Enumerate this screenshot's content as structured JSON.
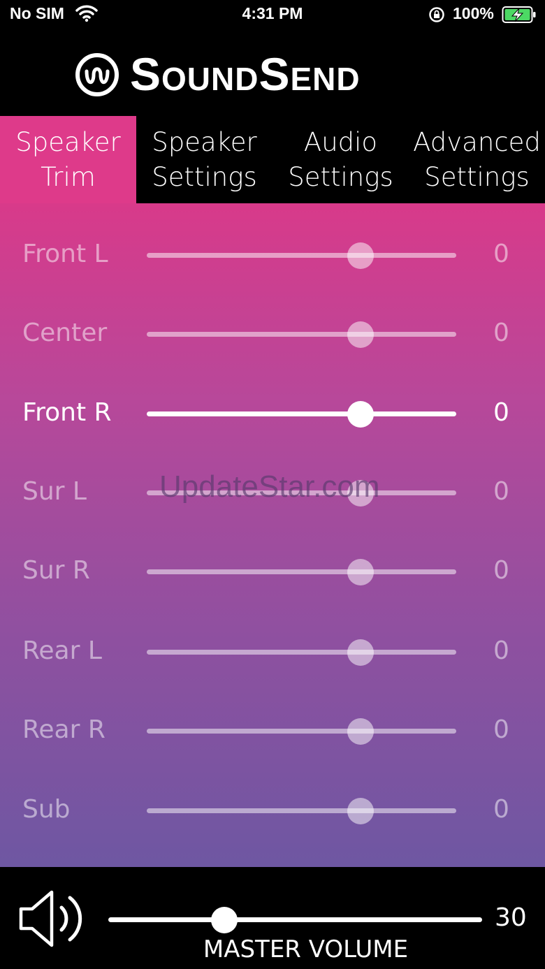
{
  "status_bar": {
    "carrier": "No SIM",
    "time": "4:31 PM",
    "battery_percent": "100%"
  },
  "header": {
    "brand": "SoundSend",
    "logo_icon": "waveform-circle-icon"
  },
  "tabs": [
    {
      "label": "Speaker\nTrim",
      "active": true
    },
    {
      "label": "Speaker\nSettings",
      "active": false
    },
    {
      "label": "Audio\nSettings",
      "active": false
    },
    {
      "label": "Advanced\nSettings",
      "active": false
    }
  ],
  "channels": [
    {
      "label": "Front L",
      "value": "0",
      "level": 0.69
    },
    {
      "label": "Center",
      "value": "0",
      "level": 0.69
    },
    {
      "label": "Front R",
      "value": "0",
      "level": 0.69,
      "selected": true
    },
    {
      "label": "Sur L",
      "value": "0",
      "level": 0.69
    },
    {
      "label": "Sur R",
      "value": "0",
      "level": 0.69
    },
    {
      "label": "Rear L",
      "value": "0",
      "level": 0.69
    },
    {
      "label": "Rear R",
      "value": "0",
      "level": 0.69
    },
    {
      "label": "Sub",
      "value": "0",
      "level": 0.69
    }
  ],
  "watermark": "UpdateStar.com",
  "master": {
    "label": "MASTER VOLUME",
    "value": "30",
    "level": 0.31,
    "icon": "speaker-volume-icon"
  },
  "colors": {
    "active_tab": "#de3a8a",
    "gradient_top": "#d83a8a",
    "gradient_bottom": "#6e57a2",
    "battery_green": "#4cd964"
  }
}
